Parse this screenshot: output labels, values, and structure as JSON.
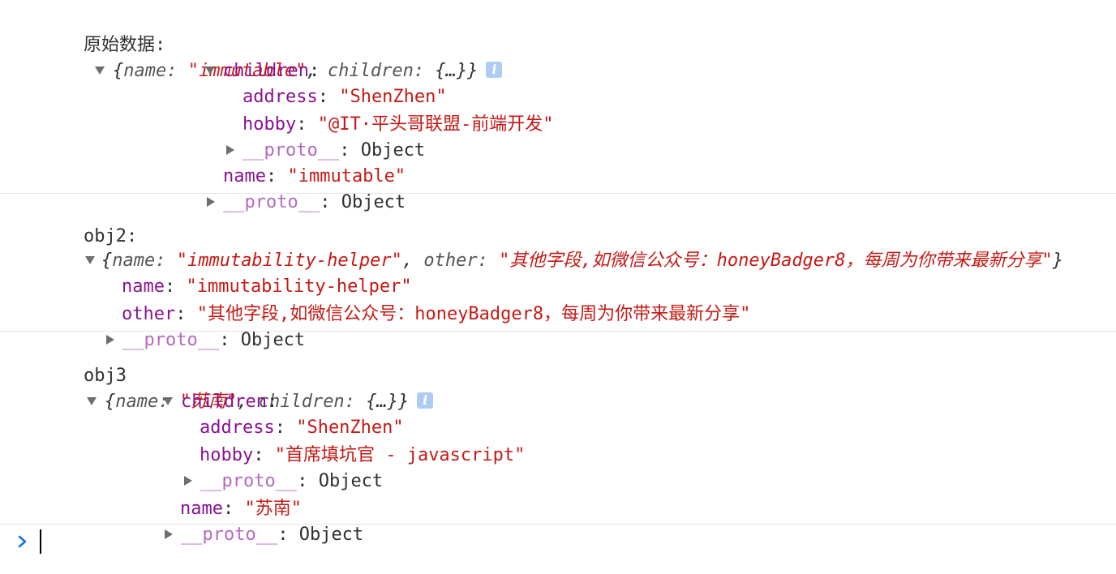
{
  "colors": {
    "key": "#881391",
    "string": "#c41a16",
    "proto": "#b46bbe",
    "prompt": "#1a73e8"
  },
  "log1": {
    "label": "原始数据:",
    "preview_open": "{",
    "preview_k1": "name",
    "preview_v1": "\"immutable\"",
    "preview_k2": "children",
    "preview_v2": "{…}",
    "preview_close": "}",
    "children_key": "children",
    "address_key": "address",
    "address_val": "\"ShenZhen\"",
    "hobby_key": "hobby",
    "hobby_val": "\"@IT·平头哥联盟-前端开发\"",
    "proto_key": "__proto__",
    "proto_val": "Object",
    "name_key": "name",
    "name_val": "\"immutable\""
  },
  "log2": {
    "label": "obj2:",
    "preview_open": "{",
    "preview_k1": "name",
    "preview_v1": "\"immutability-helper\"",
    "preview_k2": "other",
    "preview_v2": "\"其他字段,如微信公众号：honeyBadger8，每周为你带来最新分享\"",
    "preview_close": "}",
    "name_key": "name",
    "name_val": "\"immutability-helper\"",
    "other_key": "other",
    "other_val": "\"其他字段,如微信公众号：honeyBadger8，每周为你带来最新分享\"",
    "proto_key": "__proto__",
    "proto_val": "Object"
  },
  "log3": {
    "label": "obj3",
    "preview_open": "{",
    "preview_k1": "name",
    "preview_v1": "\"苏南\"",
    "preview_k2": "children",
    "preview_v2": "{…}",
    "preview_close": "}",
    "children_key": "children",
    "address_key": "address",
    "address_val": "\"ShenZhen\"",
    "hobby_key": "hobby",
    "hobby_val": "\"首席填坑官 - javascript\"",
    "proto_key": "__proto__",
    "proto_val": "Object",
    "name_key": "name",
    "name_val": "\"苏南\""
  }
}
